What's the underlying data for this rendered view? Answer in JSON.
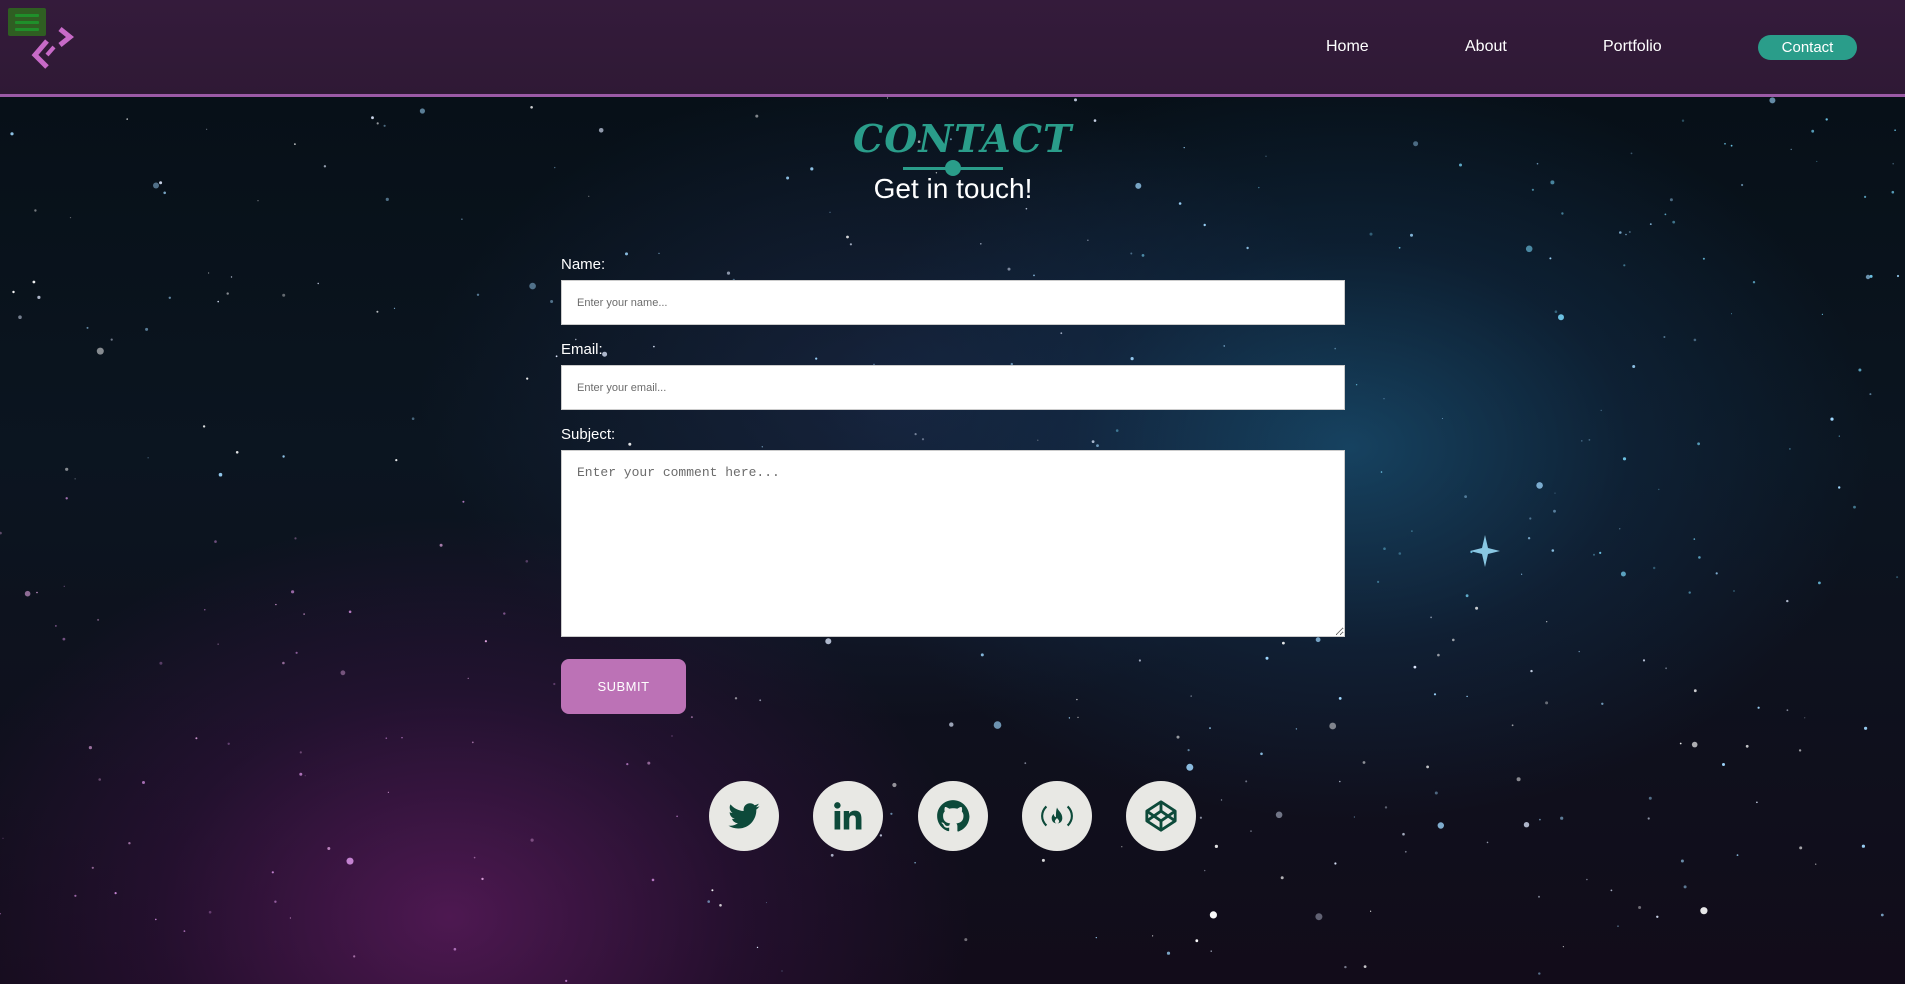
{
  "header": {
    "menu_icon": "hamburger-menu-icon",
    "logo_icon": "code-brackets-logo-icon",
    "nav": [
      {
        "label": "Home"
      },
      {
        "label": "About"
      },
      {
        "label": "Portfolio"
      },
      {
        "label": "Contact"
      }
    ],
    "colors": {
      "header_bg": "#341b3b",
      "header_border": "#9b5aa6",
      "accent": "#2a9d8a",
      "logo": "#c86ac8"
    }
  },
  "section": {
    "title": "CONTACT",
    "subtitle": "Get in touch!"
  },
  "form": {
    "name_label": "Name:",
    "name_placeholder": "Enter your name...",
    "email_label": "Email:",
    "email_placeholder": "Enter your email...",
    "subject_label": "Subject:",
    "subject_placeholder": "Enter your comment here...",
    "submit_label": "SUBMIT",
    "submit_color": "#bc72b6"
  },
  "social": [
    {
      "icon": "twitter-icon"
    },
    {
      "icon": "linkedin-icon"
    },
    {
      "icon": "github-icon"
    },
    {
      "icon": "freecodecamp-icon"
    },
    {
      "icon": "codepen-icon"
    }
  ],
  "social_icon_color": "#0d4a3a"
}
